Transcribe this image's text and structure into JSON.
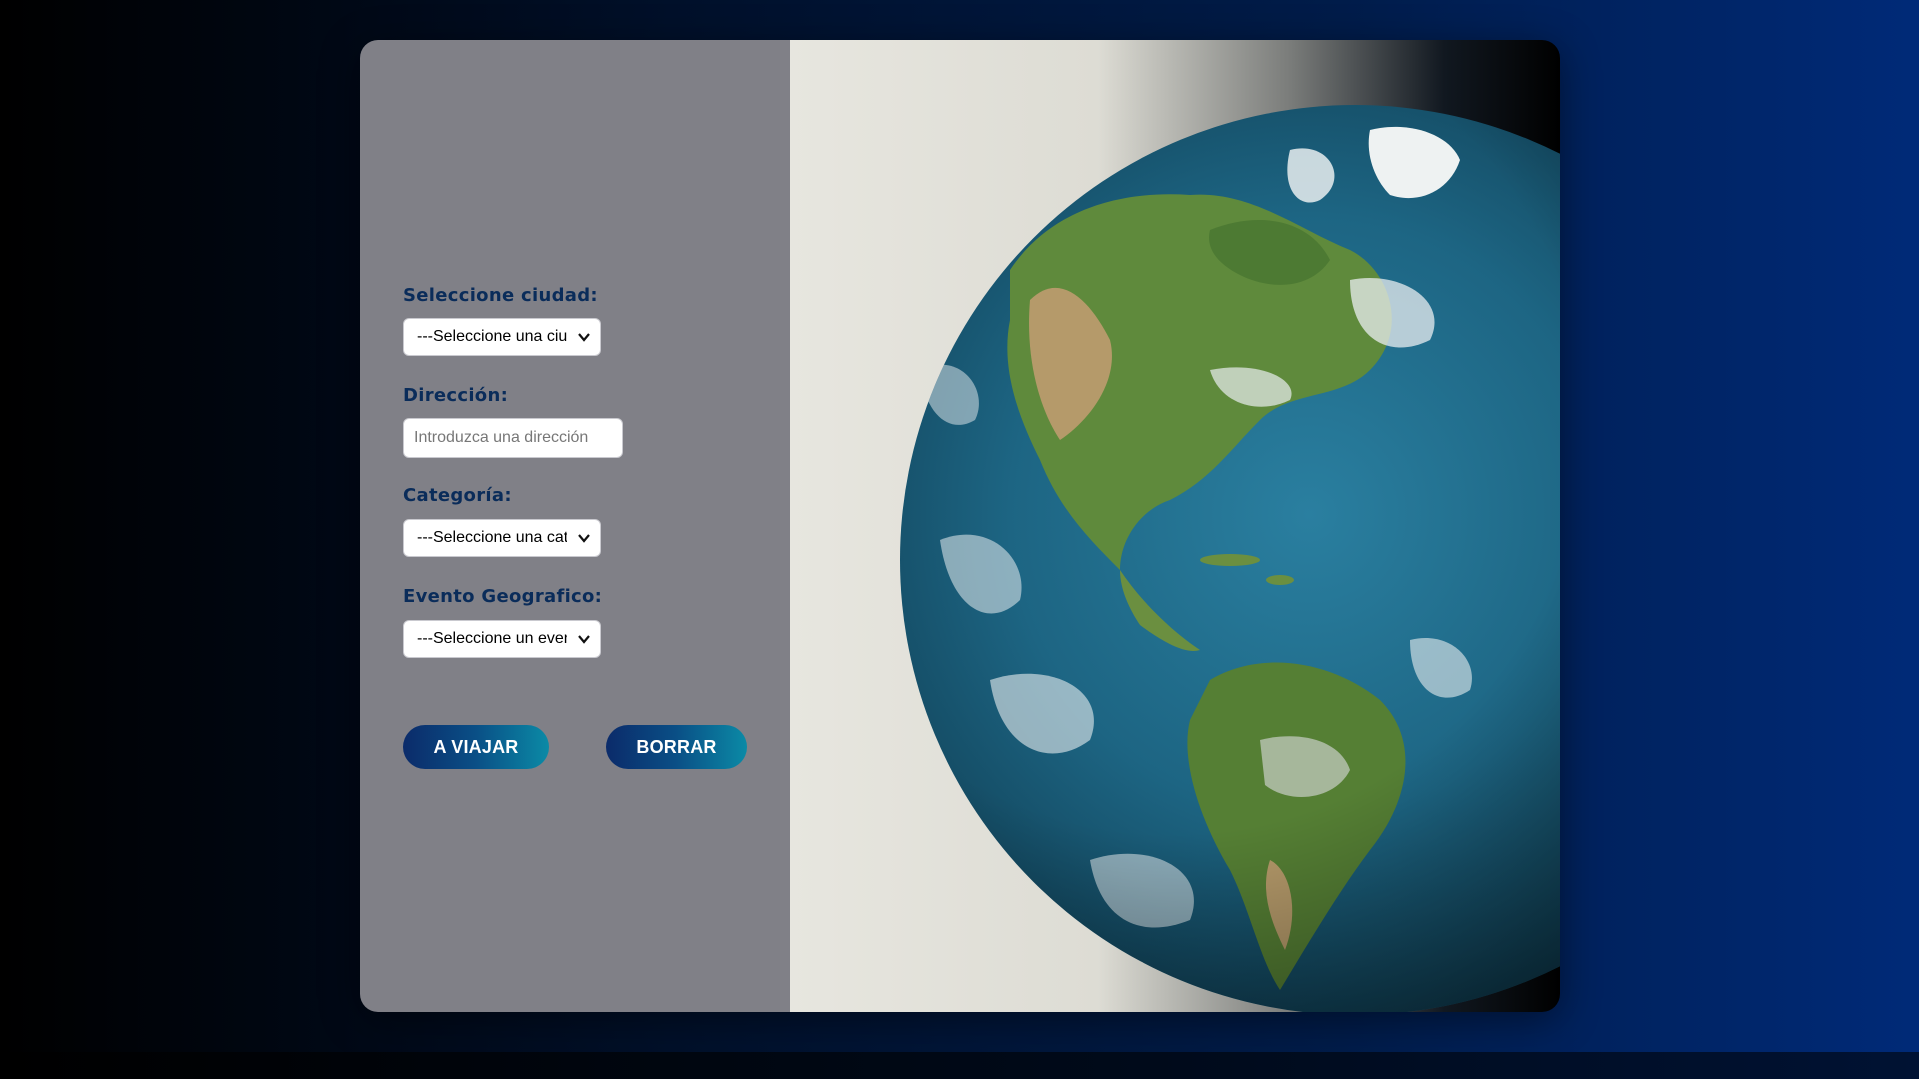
{
  "form": {
    "city": {
      "label": "Seleccione ciudad:",
      "selected": "---Seleccione una ciudad---"
    },
    "address": {
      "label": "Dirección:",
      "placeholder": "Introduzca una dirección",
      "value": ""
    },
    "category": {
      "label": "Categoría:",
      "selected": "---Seleccione una categoría---"
    },
    "geo_event": {
      "label": "Evento Geografico:",
      "selected": "---Seleccione un evento---"
    },
    "buttons": {
      "travel_label": "A VIAJAR",
      "clear_label": "BORRAR"
    }
  },
  "image": {
    "icon": "earth-globe-image"
  },
  "colors": {
    "label_text": "#0a2c5a",
    "panel_bg": "#808087",
    "button_gradient_start": "#0b2b6a",
    "button_gradient_end": "#0b8aa6"
  }
}
